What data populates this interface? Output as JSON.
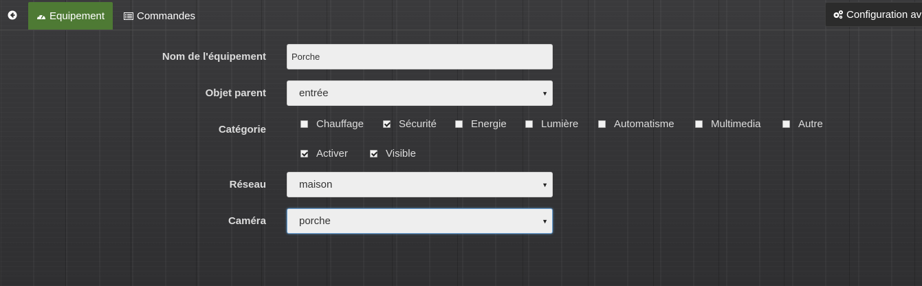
{
  "tabs": [
    {
      "label": "Equipement",
      "icon": "dashboard-icon",
      "active": true
    },
    {
      "label": "Commandes",
      "icon": "list-icon",
      "active": false
    }
  ],
  "config_button": {
    "label": "Configuration av",
    "icon": "gears-icon"
  },
  "back_icon": "circle-arrow-left-icon",
  "form": {
    "name": {
      "label": "Nom de l'équipement",
      "value": "Porche"
    },
    "parent": {
      "label": "Objet parent",
      "value": "entrée"
    },
    "category": {
      "label": "Catégorie",
      "options": [
        {
          "label": "Chauffage",
          "checked": false
        },
        {
          "label": "Sécurité",
          "checked": true
        },
        {
          "label": "Energie",
          "checked": false
        },
        {
          "label": "Lumière",
          "checked": false
        },
        {
          "label": "Automatisme",
          "checked": false
        },
        {
          "label": "Multimedia",
          "checked": false
        },
        {
          "label": "Autre",
          "checked": false
        }
      ]
    },
    "activate": {
      "label": "Activer",
      "checked": true
    },
    "visible": {
      "label": "Visible",
      "checked": true
    },
    "network": {
      "label": "Réseau",
      "value": "maison"
    },
    "camera": {
      "label": "Caméra",
      "value": "porche"
    }
  },
  "colors": {
    "active_tab": "#4e7a34",
    "focus_border": "#6a9fd4"
  }
}
